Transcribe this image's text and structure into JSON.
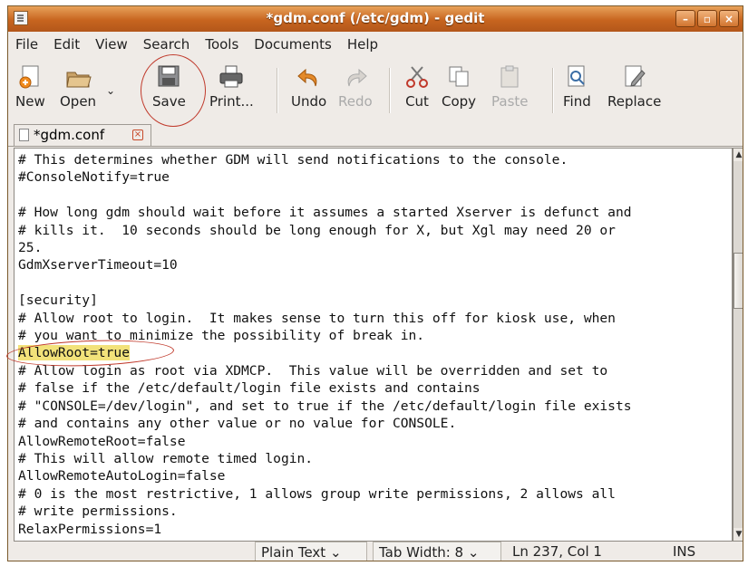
{
  "window": {
    "title": "*gdm.conf (/etc/gdm) - gedit",
    "min": "–",
    "max": "▫",
    "close": "×"
  },
  "menu": {
    "items": [
      "File",
      "Edit",
      "View",
      "Search",
      "Tools",
      "Documents",
      "Help"
    ]
  },
  "toolbar": {
    "new": "New",
    "open": "Open",
    "save": "Save",
    "print": "Print...",
    "undo": "Undo",
    "redo": "Redo",
    "cut": "Cut",
    "copy": "Copy",
    "paste": "Paste",
    "find": "Find",
    "replace": "Replace"
  },
  "tab": {
    "label": "*gdm.conf",
    "close": "×"
  },
  "editor": {
    "lines_before": [
      "# This determines whether GDM will send notifications to the console.",
      "#ConsoleNotify=true",
      "",
      "# How long gdm should wait before it assumes a started Xserver is defunct and",
      "# kills it.  10 seconds should be long enough for X, but Xgl may need 20 or",
      "25.",
      "GdmXserverTimeout=10",
      "",
      "[security]",
      "# Allow root to login.  It makes sense to turn this off for kiosk use, when",
      "# you want to minimize the possibility of break in."
    ],
    "highlighted_line": "AllowRoot=true",
    "lines_after": [
      "# Allow login as root via XDMCP.  This value will be overridden and set to",
      "# false if the /etc/default/login file exists and contains",
      "# \"CONSOLE=/dev/login\", and set to true if the /etc/default/login file exists",
      "# and contains any other value or no value for CONSOLE.",
      "AllowRemoteRoot=false",
      "# This will allow remote timed login.",
      "AllowRemoteAutoLogin=false",
      "# 0 is the most restrictive, 1 allows group write permissions, 2 allows all",
      "# write permissions.",
      "RelaxPermissions=1"
    ]
  },
  "statusbar": {
    "language": "Plain Text",
    "tab_width": "Tab Width:  8",
    "position": "Ln 237, Col 1",
    "mode": "INS"
  },
  "colors": {
    "titlebar": "#c7641f",
    "highlight": "#f2e27a",
    "annotation": "#c0392b"
  }
}
